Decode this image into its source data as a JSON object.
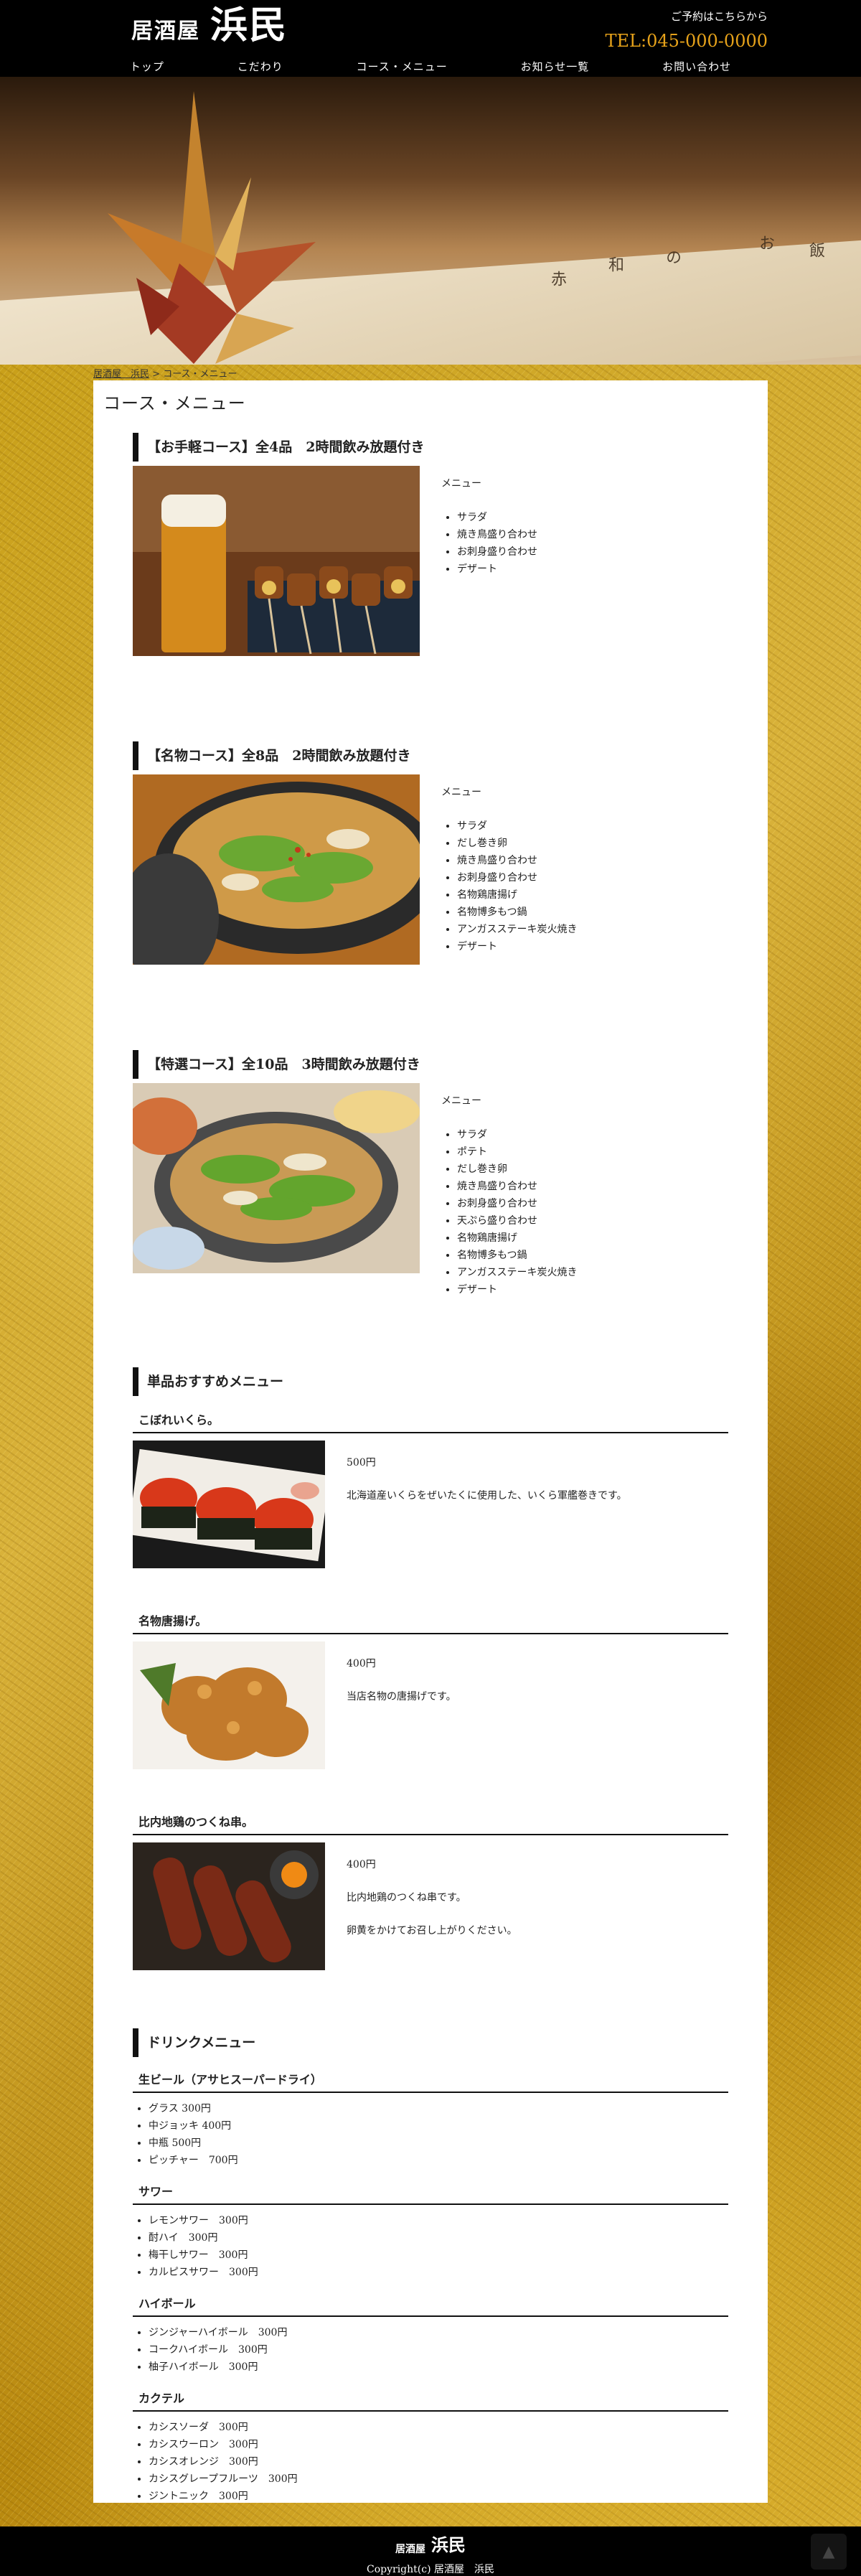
{
  "header": {
    "logo_small": "居酒屋",
    "logo_big": "浜民",
    "reserve_label": "ご予約はこちらから",
    "tel": "TEL:045-000-0000"
  },
  "nav": [
    "トップ",
    "こだわり",
    "コース・メニュー",
    "お知らせ一覧",
    "お問い合わせ"
  ],
  "breadcrumb": {
    "home": "居酒屋　浜民",
    "separator": ">",
    "current": "コース・メニュー"
  },
  "page_title": "コース・メニュー",
  "courses": [
    {
      "title": "【お手軽コース】全4品　2時間飲み放題付き",
      "menu_label": "メニュー",
      "items": [
        "サラダ",
        "焼き鳥盛り合わせ",
        "お刺身盛り合わせ",
        "デザート"
      ]
    },
    {
      "title": "【名物コース】全8品　2時間飲み放題付き",
      "menu_label": "メニュー",
      "items": [
        "サラダ",
        "だし巻き卵",
        "焼き鳥盛り合わせ",
        "お刺身盛り合わせ",
        "名物鶏唐揚げ",
        "名物博多もつ鍋",
        "アンガスステーキ炭火焼き",
        "デザート"
      ]
    },
    {
      "title": "【特選コース】全10品　3時間飲み放題付き",
      "menu_label": "メニュー",
      "items": [
        "サラダ",
        "ポテト",
        "だし巻き卵",
        "焼き鳥盛り合わせ",
        "お刺身盛り合わせ",
        "天ぷら盛り合わせ",
        "名物鶏唐揚げ",
        "名物博多もつ鍋",
        "アンガスステーキ炭火焼き",
        "デザート"
      ]
    }
  ],
  "single_menu": {
    "title": "単品おすすめメニュー",
    "items": [
      {
        "name": "こぼれいくら。",
        "price": "500円",
        "desc": [
          "北海道産いくらをぜいたくに使用した、いくら軍艦巻きです。"
        ]
      },
      {
        "name": "名物唐揚げ。",
        "price": "400円",
        "desc": [
          "当店名物の唐揚げです。"
        ]
      },
      {
        "name": "比内地鶏のつくね串。",
        "price": "400円",
        "desc": [
          "比内地鶏のつくね串です。",
          "卵黄をかけてお召し上がりください。"
        ]
      }
    ]
  },
  "drinks": {
    "title": "ドリンクメニュー",
    "categories": [
      {
        "name": "生ビール（アサヒスーパードライ）",
        "items": [
          "グラス 300円",
          "中ジョッキ 400円",
          "中瓶 500円",
          "ピッチャー　700円"
        ]
      },
      {
        "name": "サワー",
        "items": [
          "レモンサワー　300円",
          "酎ハイ　300円",
          "梅干しサワー　300円",
          "カルピスサワー　300円"
        ]
      },
      {
        "name": "ハイボール",
        "items": [
          "ジンジャーハイボール　300円",
          "コークハイボール　300円",
          "柚子ハイボール　300円"
        ]
      },
      {
        "name": "カクテル",
        "items": [
          "カシスソーダ　300円",
          "カシスウーロン　300円",
          "カシスオレンジ　300円",
          "カシスグレープフルーツ　300円",
          "ジントニック　300円"
        ]
      }
    ]
  },
  "footer": {
    "logo_small": "居酒屋",
    "logo_big": "浜民",
    "copyright": "Copyright(c) 居酒屋　浜民"
  },
  "hero_vertical_text": [
    "赤",
    "和",
    "の",
    "お",
    "飯"
  ],
  "colors": {
    "tel": "#e6a21a",
    "header_bg": "#000000",
    "gold": "#c9a01a"
  }
}
